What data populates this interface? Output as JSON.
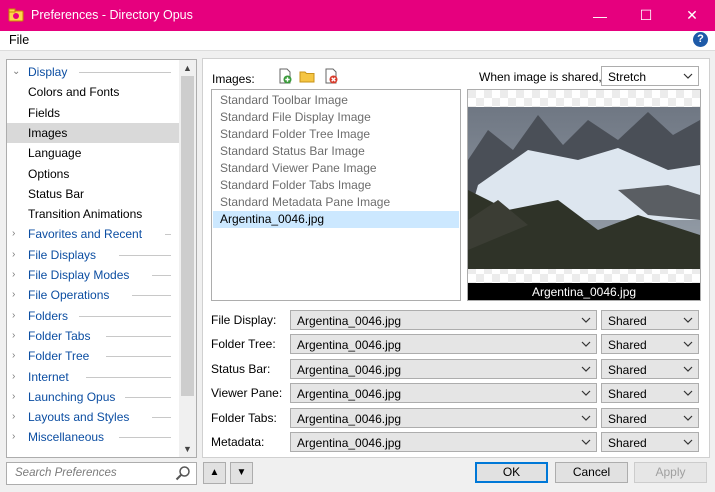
{
  "window": {
    "title": "Preferences - Directory Opus",
    "minimize_glyph": "—",
    "maximize_glyph": "☐",
    "close_glyph": "✕"
  },
  "menubar": {
    "file": "File",
    "help_glyph": "?"
  },
  "tree": {
    "items": [
      {
        "label": "Display",
        "expanded": true,
        "category": true
      },
      {
        "label": "Colors and Fonts"
      },
      {
        "label": "Fields"
      },
      {
        "label": "Images",
        "selected": true
      },
      {
        "label": "Language"
      },
      {
        "label": "Options"
      },
      {
        "label": "Status Bar"
      },
      {
        "label": "Transition Animations"
      },
      {
        "label": "Favorites and Recent",
        "category": true
      },
      {
        "label": "File Displays",
        "category": true
      },
      {
        "label": "File Display Modes",
        "category": true
      },
      {
        "label": "File Operations",
        "category": true
      },
      {
        "label": "Folders",
        "category": true
      },
      {
        "label": "Folder Tabs",
        "category": true
      },
      {
        "label": "Folder Tree",
        "category": true
      },
      {
        "label": "Internet",
        "category": true
      },
      {
        "label": "Launching Opus",
        "category": true
      },
      {
        "label": "Layouts and Styles",
        "category": true
      },
      {
        "label": "Miscellaneous",
        "category": true
      }
    ],
    "caret_expanded": "⌄",
    "caret_collapsed": "›",
    "scroll_up": "▲",
    "scroll_down": "▼"
  },
  "search": {
    "placeholder": "Search Preferences"
  },
  "nav": {
    "up": "▲",
    "down": "▼"
  },
  "images_panel": {
    "images_label": "Images:",
    "shared_label": "When image is shared,",
    "shared_mode": "Stretch",
    "list": [
      "Standard Toolbar Image",
      "Standard File Display Image",
      "Standard Folder Tree Image",
      "Standard Status Bar Image",
      "Standard Viewer Pane Image",
      "Standard Folder Tabs Image",
      "Standard Metadata Pane Image",
      "Argentina_0046.jpg"
    ],
    "selected_index": 7,
    "preview_caption": "Argentina_0046.jpg"
  },
  "assignments": [
    {
      "label": "File Display:",
      "image": "Argentina_0046.jpg",
      "mode": "Shared"
    },
    {
      "label": "Folder Tree:",
      "image": "Argentina_0046.jpg",
      "mode": "Shared"
    },
    {
      "label": "Status Bar:",
      "image": "Argentina_0046.jpg",
      "mode": "Shared"
    },
    {
      "label": "Viewer Pane:",
      "image": "Argentina_0046.jpg",
      "mode": "Shared"
    },
    {
      "label": "Folder Tabs:",
      "image": "Argentina_0046.jpg",
      "mode": "Shared"
    },
    {
      "label": "Metadata:",
      "image": "Argentina_0046.jpg",
      "mode": "Shared"
    }
  ],
  "buttons": {
    "ok": "OK",
    "cancel": "Cancel",
    "apply": "Apply"
  },
  "colors": {
    "titlebar": "#e6007e",
    "category_text": "#0c4ea2",
    "selection": "#cce8ff",
    "focus": "#0078d7"
  }
}
